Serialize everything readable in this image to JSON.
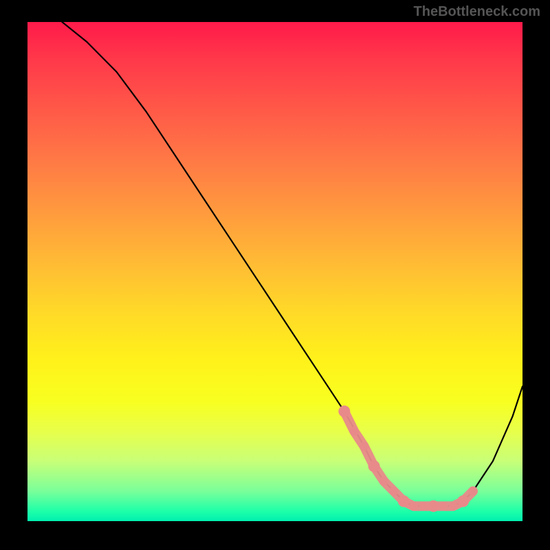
{
  "watermark": "TheBottleneck.com",
  "chart_data": {
    "type": "line",
    "title": "",
    "xlabel": "",
    "ylabel": "",
    "xlim": [
      0,
      100
    ],
    "ylim": [
      0,
      100
    ],
    "series": [
      {
        "name": "bottleneck-curve",
        "x": [
          7,
          12,
          18,
          24,
          30,
          36,
          42,
          48,
          54,
          60,
          64,
          68,
          70,
          72,
          74,
          76,
          78,
          80,
          82,
          84,
          86,
          88,
          90,
          94,
          98,
          100
        ],
        "y": [
          100,
          96,
          90,
          82,
          73,
          64,
          55,
          46,
          37,
          28,
          22,
          15,
          11,
          8,
          6,
          4,
          3,
          3,
          3,
          3,
          3,
          4,
          6,
          12,
          21,
          27
        ]
      }
    ],
    "markers": {
      "name": "highlight-region",
      "color": "#e88a8a",
      "x": [
        64,
        66,
        68,
        70,
        72,
        74,
        76,
        78,
        80,
        82,
        84,
        86,
        88,
        90
      ],
      "y": [
        22,
        18,
        15,
        11,
        8,
        6,
        4,
        3,
        3,
        3,
        3,
        3,
        4,
        6
      ]
    },
    "background_gradient": {
      "top": "#ff1a4a",
      "mid": "#ffd928",
      "bottom": "#00f0b0"
    }
  }
}
